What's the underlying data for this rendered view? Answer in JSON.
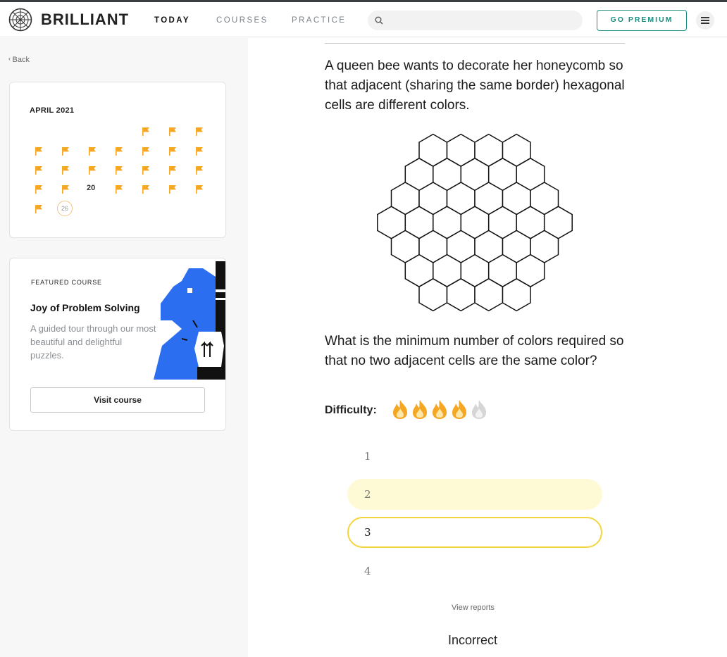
{
  "header": {
    "brand": "BRILLIANT",
    "nav": [
      "TODAY",
      "COURSES",
      "PRACTICE"
    ],
    "active_nav": "TODAY",
    "search_placeholder": "",
    "premium_label": "GO PREMIUM"
  },
  "sidebar": {
    "back_label": "Back",
    "calendar": {
      "month": "APRIL 2021",
      "day_20_label": "20",
      "today_label": "26"
    },
    "featured": {
      "label": "FEATURED COURSE",
      "title": "Joy of Problem Solving",
      "description": "A guided tour through our most beautiful and delightful puzzles.",
      "button": "Visit course"
    }
  },
  "problem": {
    "text_1": "A queen bee wants to decorate her honeycomb so that adjacent (sharing the same border) hexagonal cells are different colors.",
    "text_2": "What is the minimum number of colors required so that no two adjacent cells are the same color?",
    "difficulty_label": "Difficulty:",
    "difficulty_level": 4,
    "difficulty_max": 5,
    "options": [
      "1",
      "2",
      "3",
      "4"
    ],
    "selected_option": "3",
    "highlighted_option": "2",
    "reports_link": "View reports",
    "result": "Incorrect"
  },
  "colors": {
    "flag": "#f5a623",
    "premium": "#1a8f81",
    "flame": "#f5a623",
    "flame_inactive": "#d6d6d6",
    "chess_blue": "#2b6ef0"
  }
}
